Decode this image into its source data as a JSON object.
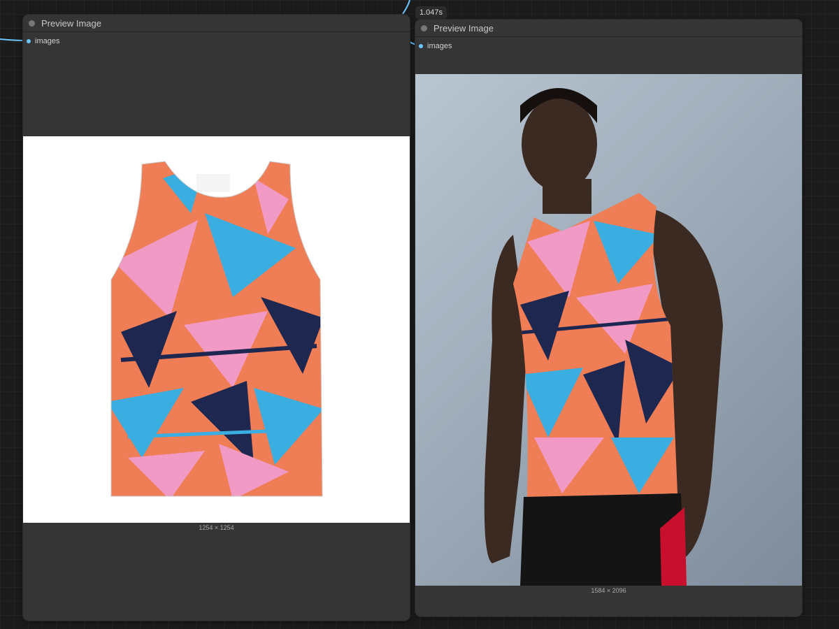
{
  "canvas": {
    "timing_badge": "1.047s"
  },
  "nodes": [
    {
      "title": "Preview Image",
      "input_label": "images",
      "image_description": "tank top product photo",
      "dimensions": "1254 × 1254"
    },
    {
      "title": "Preview Image",
      "input_label": "images",
      "image_description": "model wearing tank top",
      "dimensions": "1584 × 2096"
    }
  ],
  "colors": {
    "link": "#6cc6ff",
    "node_bg": "#353535",
    "canvas_bg": "#1b1b1b",
    "pattern_orange": "#ef7d55",
    "pattern_pink": "#f29ac6",
    "pattern_blue": "#3aaee0",
    "pattern_navy": "#1e2750"
  }
}
